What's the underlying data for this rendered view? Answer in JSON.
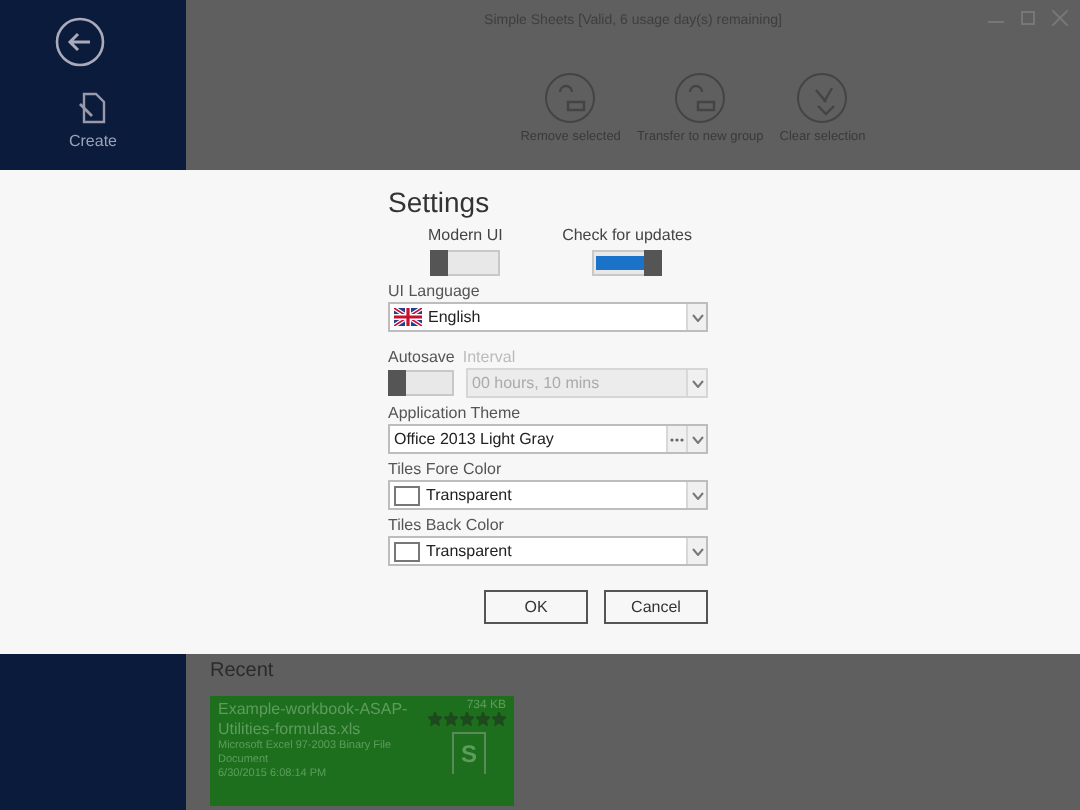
{
  "window": {
    "title": "Simple Sheets [Valid, 6 usage day(s) remaining]"
  },
  "sidebar": {
    "items": [
      {
        "label": "Create"
      }
    ]
  },
  "toolbar": {
    "buttons": [
      {
        "label": "Remove selected"
      },
      {
        "label": "Transfer to new group"
      },
      {
        "label": "Clear selection"
      }
    ]
  },
  "settings": {
    "title": "Settings",
    "toggles": [
      {
        "label": "Modern UI",
        "on": false
      },
      {
        "label": "Check for updates",
        "on": true
      }
    ],
    "ui_language": {
      "label": "UI Language",
      "value": "English"
    },
    "autosave": {
      "label": "Autosave",
      "on": false,
      "interval_label": "Interval",
      "interval_value": "00 hours, 10 mins",
      "disabled": true
    },
    "application_theme": {
      "label": "Application Theme",
      "value": "Office 2013 Light Gray"
    },
    "tiles_fore_color": {
      "label": "Tiles Fore Color",
      "value": "Transparent"
    },
    "tiles_back_color": {
      "label": "Tiles Back Color",
      "value": "Transparent"
    },
    "buttons": [
      "OK",
      "Cancel"
    ]
  },
  "recent": {
    "title": "Recent",
    "files": [
      {
        "name": "Example-workbook-ASAP-Utilities-formulas.xls",
        "size": "734 KB",
        "type": "Microsoft Excel 97-2003 Binary File Document",
        "date": "6/30/2015 6:08:14 PM",
        "stars": 5,
        "badge": "S"
      }
    ]
  }
}
